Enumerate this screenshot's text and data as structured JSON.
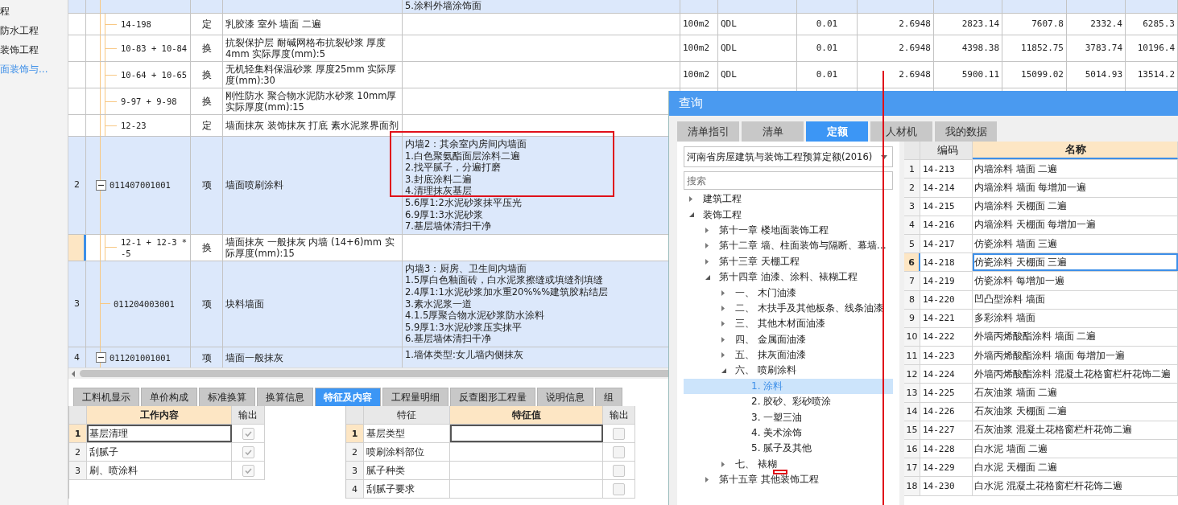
{
  "sidebar": {
    "items": [
      {
        "label": "程",
        "selected": false
      },
      {
        "label": "防水工程",
        "selected": false
      },
      {
        "label": "装饰工程",
        "selected": false
      },
      {
        "label": "面装饰与...",
        "selected": true
      }
    ]
  },
  "main_table": {
    "rows": [
      {
        "kind": "item",
        "selected": false,
        "features": "5.涂料外墙涂饰面"
      },
      {
        "kind": "sub",
        "selected": false,
        "code": "14-198",
        "type": "定",
        "name": "乳胶漆 室外 墙面 二遍",
        "cells": [
          "100m2",
          "QDL",
          "0.01",
          "2.6948",
          "2823.14",
          "7607.8",
          "2332.4",
          "6285.3"
        ]
      },
      {
        "kind": "sub",
        "selected": false,
        "code": "10-83 + 10-84",
        "type": "换",
        "name": "抗裂保护层 耐碱网格布抗裂砂浆 厚度4mm 实际厚度(mm):5",
        "cells": [
          "100m2",
          "QDL",
          "0.01",
          "2.6948",
          "4398.38",
          "11852.75",
          "3783.74",
          "10196.4"
        ]
      },
      {
        "kind": "sub",
        "selected": false,
        "code": "10-64 + 10-65",
        "type": "换",
        "name": "无机轻集料保温砂浆 厚度25mm  实际厚度(mm):30",
        "cells": [
          "100m2",
          "QDL",
          "0.01",
          "2.6948",
          "5900.11",
          "15099.02",
          "5014.93",
          "13514.2"
        ]
      },
      {
        "kind": "sub",
        "selected": false,
        "code": "9-97 + 9-98",
        "type": "换",
        "name": "刚性防水 聚合物水泥防水砂浆 10mm厚实际厚度(mm):15"
      },
      {
        "kind": "sub",
        "selected": false,
        "code": "12-23",
        "type": "定",
        "name": "墙面抹灰 装饰抹灰 打底 素水泥浆界面剂"
      },
      {
        "kind": "item",
        "selected": false,
        "num": "2",
        "expanded": true,
        "code": "011407001001",
        "type": "项",
        "name": "墙面喷刷涂料",
        "features": "内墙2：其余室内房间内墙面\n1.白色聚氨酯面层涂料二遍\n2.找平腻子，分遍打磨\n3.封底涂料二遍\n4.清理抹灰基层\n5.6厚1:2水泥砂浆抹平压光\n6.9厚1:3水泥砂浆\n7.基层墙体清扫干净"
      },
      {
        "kind": "sub",
        "selected": true,
        "code": "12-1 + 12-3 * -5",
        "type": "换",
        "name": "墙面抹灰 一般抹灰 内墙 (14+6)mm  实际厚度(mm):15"
      },
      {
        "kind": "item",
        "selected": false,
        "num": "3",
        "code": "011204003001",
        "type": "项",
        "name": "块料墙面",
        "features": "内墙3：厨房、卫生间内墙面\n1.5厚白色釉面砖，白水泥浆擦缝或填缝剂填缝\n2.4厚1:1水泥砂浆加水重20%%%建筑胶粘结层\n3.素水泥浆一道\n4.1.5厚聚合物水泥砂浆防水涂料\n5.9厚1:3水泥砂浆压实抹平\n6.基层墙体清扫干净"
      },
      {
        "kind": "item",
        "selected": false,
        "num": "4",
        "expanded": true,
        "code": "011201001001",
        "type": "项",
        "name": "墙面一般抹灰",
        "features": "1.墙体类型:女儿墙内侧抹灰"
      }
    ]
  },
  "bottom_tabs": [
    {
      "label": "工料机显示",
      "selected": false
    },
    {
      "label": "单价构成",
      "selected": false
    },
    {
      "label": "标准换算",
      "selected": false
    },
    {
      "label": "换算信息",
      "selected": false
    },
    {
      "label": "特征及内容",
      "selected": true
    },
    {
      "label": "工程量明细",
      "selected": false
    },
    {
      "label": "反查图形工程量",
      "selected": false
    },
    {
      "label": "说明信息",
      "selected": false
    },
    {
      "label": "组",
      "selected": false
    }
  ],
  "work_table": {
    "columns": [
      "工作内容",
      "输出"
    ],
    "rows": [
      {
        "num": "1",
        "content": "基层清理",
        "checked": true,
        "selected": true
      },
      {
        "num": "2",
        "content": "刮腻子",
        "checked": true,
        "selected": false
      },
      {
        "num": "3",
        "content": "刷、喷涂料",
        "checked": true,
        "selected": false
      }
    ]
  },
  "feature_table": {
    "columns": [
      "特征",
      "特征值",
      "输出"
    ],
    "rows": [
      {
        "num": "1",
        "feature": "基层类型",
        "checked": false,
        "selected": true
      },
      {
        "num": "2",
        "feature": "喷刷涂料部位",
        "checked": false,
        "selected": false
      },
      {
        "num": "3",
        "feature": "腻子种类",
        "checked": false,
        "selected": false
      },
      {
        "num": "4",
        "feature": "刮腻子要求",
        "checked": false,
        "selected": false
      }
    ]
  },
  "dialog": {
    "title": "查询",
    "tabs": [
      {
        "label": "清单指引",
        "selected": false
      },
      {
        "label": "清单",
        "selected": false
      },
      {
        "label": "定额",
        "selected": true
      },
      {
        "label": "人材机",
        "selected": false
      },
      {
        "label": "我的数据",
        "selected": false
      }
    ],
    "library": "河南省房屋建筑与装饰工程预算定额(2016)",
    "search": {
      "placeholder": "搜索"
    },
    "tree": [
      {
        "label": "建筑工程",
        "expanded": false,
        "selected": false
      },
      {
        "label": "装饰工程",
        "expanded": true,
        "selected": false,
        "children": [
          {
            "label": "第十一章  楼地面装饰工程",
            "expanded": false,
            "selected": false
          },
          {
            "label": "第十二章  墙、柱面装饰与隔断、幕墙…",
            "expanded": false,
            "selected": false
          },
          {
            "label": "第十三章  天棚工程",
            "expanded": false,
            "selected": false
          },
          {
            "label": "第十四章  油漆、涂料、裱糊工程",
            "expanded": true,
            "selected": false,
            "children": [
              {
                "label": "一、  木门油漆",
                "expanded": false,
                "selected": false
              },
              {
                "label": "二、  木扶手及其他板条、线条油漆",
                "expanded": false,
                "selected": false
              },
              {
                "label": "三、  其他木材面油漆",
                "expanded": false,
                "selected": false
              },
              {
                "label": "四、  金属面油漆",
                "expanded": false,
                "selected": false
              },
              {
                "label": "五、  抹灰面油漆",
                "expanded": false,
                "selected": false
              },
              {
                "label": "六、  喷刷涂料",
                "expanded": true,
                "selected": false,
                "children": [
                  {
                    "label": "1.  涂料",
                    "selected": true
                  },
                  {
                    "label": "2.  胶砂、彩砂喷涂",
                    "selected": false
                  },
                  {
                    "label": "3.  一塑三油",
                    "selected": false
                  },
                  {
                    "label": "4.  美术涂饰",
                    "selected": false
                  },
                  {
                    "label": "5.  腻子及其他",
                    "selected": false
                  }
                ]
              },
              {
                "label": "七、  裱糊",
                "expanded": false,
                "selected": false
              }
            ]
          },
          {
            "label": "第十五章  其他装饰工程",
            "expanded": false,
            "selected": false
          }
        ]
      }
    ],
    "table": {
      "columns": [
        "编码",
        "名称"
      ],
      "rows": [
        {
          "num": "1",
          "code": "14-213",
          "name": "内墙涂料 墙面 二遍",
          "selected": false
        },
        {
          "num": "2",
          "code": "14-214",
          "name": "内墙涂料 墙面 每增加一遍",
          "selected": false
        },
        {
          "num": "3",
          "code": "14-215",
          "name": "内墙涂料 天棚面 二遍",
          "selected": false
        },
        {
          "num": "4",
          "code": "14-216",
          "name": "内墙涂料 天棚面 每增加一遍",
          "selected": false
        },
        {
          "num": "5",
          "code": "14-217",
          "name": "仿瓷涂料 墙面 三遍",
          "selected": false
        },
        {
          "num": "6",
          "code": "14-218",
          "name": "仿瓷涂料 天棚面 三遍",
          "selected": true
        },
        {
          "num": "7",
          "code": "14-219",
          "name": "仿瓷涂料 每增加一遍",
          "selected": false
        },
        {
          "num": "8",
          "code": "14-220",
          "name": "凹凸型涂料 墙面",
          "selected": false
        },
        {
          "num": "9",
          "code": "14-221",
          "name": "多彩涂料 墙面",
          "selected": false
        },
        {
          "num": "10",
          "code": "14-222",
          "name": "外墙丙烯酸酯涂料 墙面 二遍",
          "selected": false
        },
        {
          "num": "11",
          "code": "14-223",
          "name": "外墙丙烯酸酯涂料 墙面 每增加一遍",
          "selected": false
        },
        {
          "num": "12",
          "code": "14-224",
          "name": "外墙丙烯酸酯涂料 混凝土花格窗栏杆花饰二遍",
          "selected": false
        },
        {
          "num": "13",
          "code": "14-225",
          "name": "石灰油浆 墙面 二遍",
          "selected": false
        },
        {
          "num": "14",
          "code": "14-226",
          "name": "石灰油浆 天棚面 二遍",
          "selected": false
        },
        {
          "num": "15",
          "code": "14-227",
          "name": "石灰油浆 混凝土花格窗栏杆花饰二遍",
          "selected": false
        },
        {
          "num": "16",
          "code": "14-228",
          "name": "白水泥 墙面 二遍",
          "selected": false
        },
        {
          "num": "17",
          "code": "14-229",
          "name": "白水泥 天棚面 二遍",
          "selected": false
        },
        {
          "num": "18",
          "code": "14-230",
          "name": "白水泥 混凝土花格窗栏杆花饰二遍",
          "selected": false
        }
      ]
    }
  }
}
